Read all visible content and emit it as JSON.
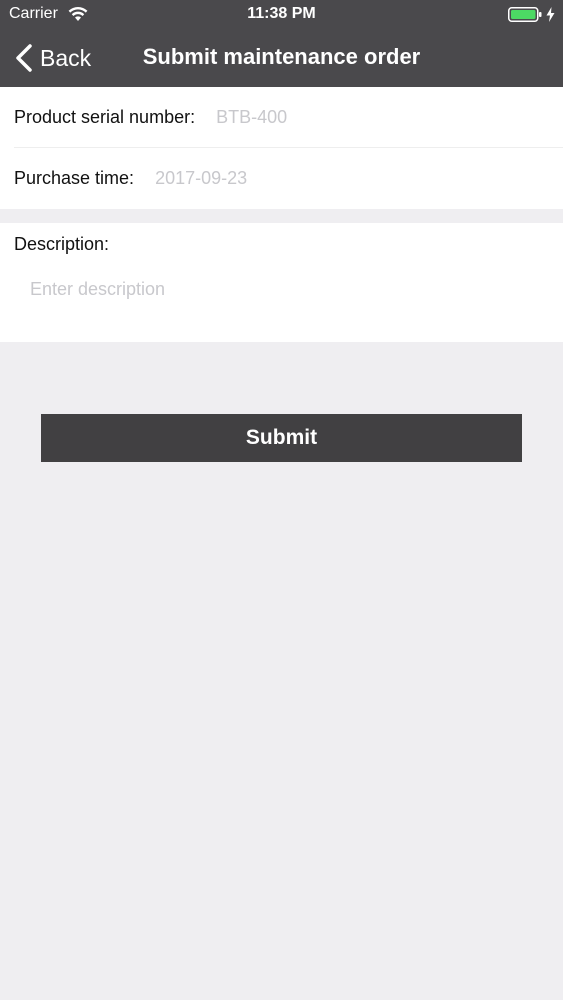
{
  "status_bar": {
    "carrier": "Carrier",
    "time": "11:38 PM",
    "wifi_icon": "wifi-icon",
    "battery_icon": "battery-icon",
    "battery_color": "#4cd964",
    "charging_icon": "charging-bolt-icon"
  },
  "nav": {
    "back_label": "Back",
    "title": "Submit maintenance order",
    "background": "#4a494c"
  },
  "form": {
    "serial": {
      "label": "Product serial number:",
      "placeholder": "BTB-400",
      "value": ""
    },
    "purchase": {
      "label": "Purchase time:",
      "placeholder": "2017-09-23",
      "value": ""
    },
    "description": {
      "label": "Description:",
      "placeholder": "Enter description",
      "value": ""
    }
  },
  "submit": {
    "label": "Submit",
    "background": "#414042"
  },
  "colors": {
    "page_background": "#efeef1",
    "placeholder": "#c8c8cc"
  }
}
